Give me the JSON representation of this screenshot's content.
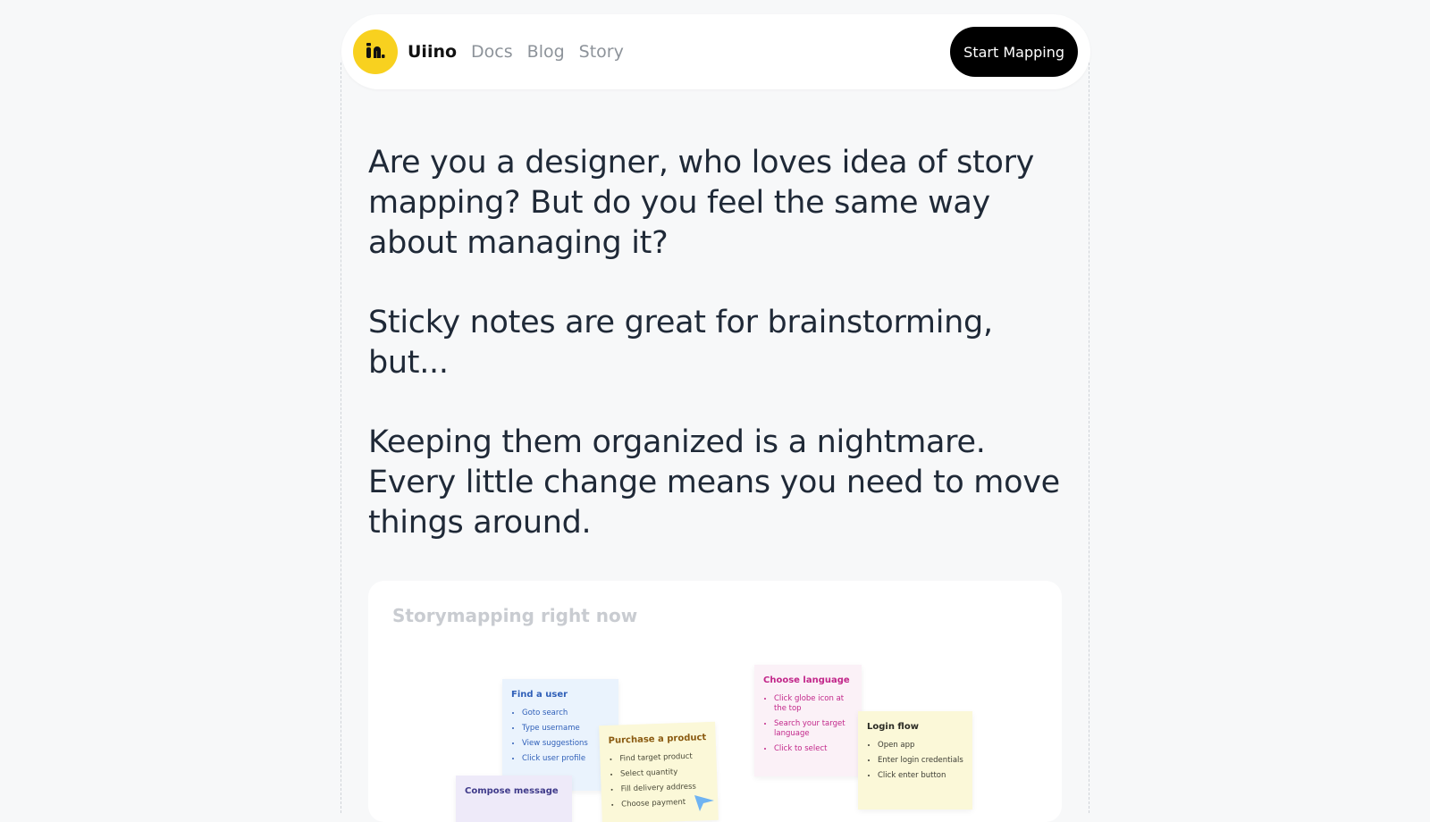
{
  "nav": {
    "brand": "Uiino",
    "links": [
      "Docs",
      "Blog",
      "Story"
    ],
    "cta": "Start Mapping"
  },
  "hero": {
    "paragraphs": [
      "Are you a designer, who loves idea of story mapping? But do you feel the same way about managing it?",
      "Sticky notes are great for brainstorming, but...",
      "Keeping them organized is a nightmare. Every little change means you need to move things around."
    ]
  },
  "card": {
    "title": "Storymapping right now",
    "notes": {
      "find_user": {
        "title": "Find a user",
        "items": [
          "Goto search",
          "Type username",
          "View suggestions",
          "Click user profile"
        ]
      },
      "purchase": {
        "title": "Purchase a product",
        "items": [
          "Find target product",
          "Select quantity",
          "Fill delivery address",
          "Choose payment"
        ]
      },
      "language": {
        "title": "Choose language",
        "items": [
          "Click globe icon at the top",
          "Search your target language",
          "Click to select"
        ]
      },
      "login": {
        "title": "Login flow",
        "items": [
          "Open app",
          "Enter login credentials",
          "Click enter button"
        ]
      },
      "compose": {
        "title": "Compose message"
      }
    }
  },
  "colors": {
    "logo": "#f8d11f",
    "cta_bg": "#000000",
    "background": "#f7f8f9"
  }
}
